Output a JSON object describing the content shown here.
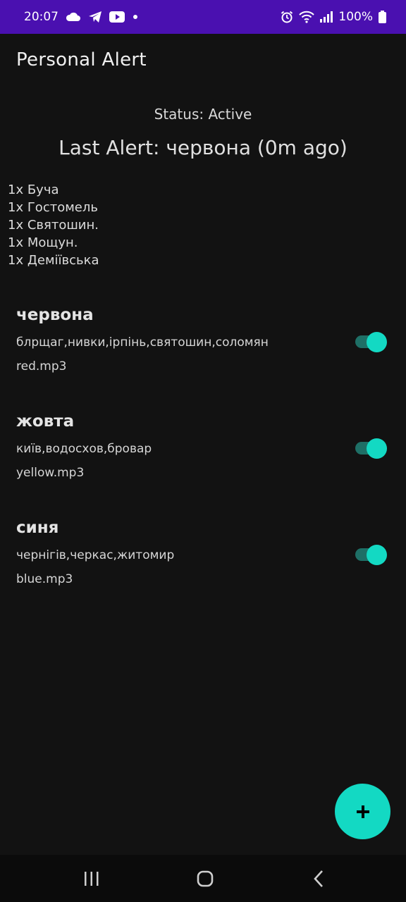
{
  "status_bar": {
    "time": "20:07",
    "battery": "100%",
    "left_icons": [
      "cloud-icon",
      "telegram-icon",
      "youtube-icon",
      "dot-icon"
    ],
    "right_icons": [
      "alarm-icon",
      "wifi-icon",
      "signal-icon",
      "battery-icon"
    ]
  },
  "app": {
    "title": "Personal Alert"
  },
  "status": {
    "text": "Status: Active"
  },
  "last_alert": {
    "text": "Last Alert: червона (0m ago)"
  },
  "locations": [
    "1x Буча",
    "1x Гостомель",
    "1x Святошин.",
    "1x Мощун.",
    "1x Деміївська"
  ],
  "alerts": [
    {
      "name": "червона",
      "regions": "блрщаг,нивки,ірпінь,святошин,соломян",
      "sound": "red.mp3",
      "enabled": true
    },
    {
      "name": "жовта",
      "regions": "київ,водосхов,бровар",
      "sound": "yellow.mp3",
      "enabled": true
    },
    {
      "name": "синя",
      "regions": "чернігів,черкас,житомир",
      "sound": "blue.mp3",
      "enabled": true
    }
  ],
  "fab": {
    "icon": "plus-icon"
  },
  "nav": {
    "icons": [
      "recent-apps-icon",
      "home-icon",
      "back-icon"
    ]
  },
  "colors": {
    "accent": "#13d9c3",
    "status_bar": "#4a10b0",
    "background": "#121212"
  }
}
